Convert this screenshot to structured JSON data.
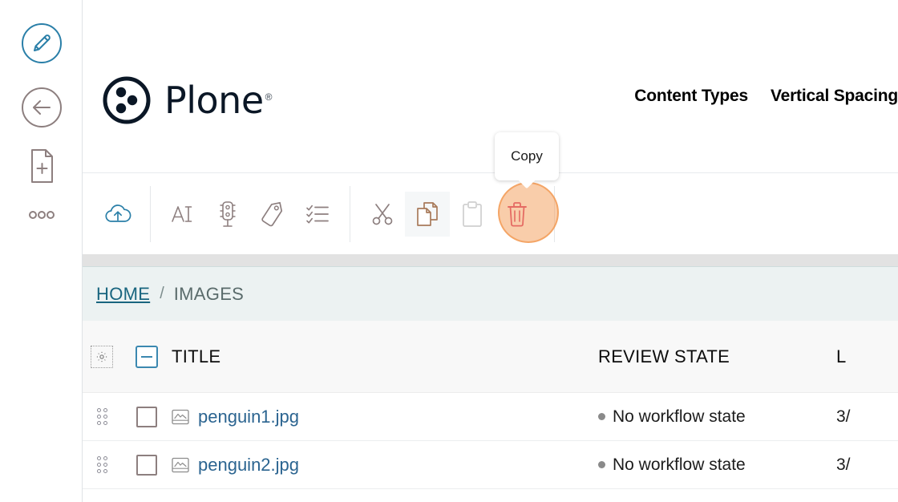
{
  "colors": {
    "brand_dark": "#0b1726",
    "link_blue": "#2b6490",
    "breadcrumb_link": "#19657f",
    "accent_orange": "#f4a05c",
    "delete_red": "#d6336c",
    "upload_blue": "#2a7fa8",
    "icon_gray": "#8d7f7f",
    "band_gray": "#e2e2e2",
    "breadcrumb_bg": "#ecf2f2"
  },
  "rail": {
    "items": [
      {
        "name": "edit-icon",
        "label": "Edit"
      },
      {
        "name": "back-arrow-icon",
        "label": "Back"
      },
      {
        "name": "add-document-icon",
        "label": "Add new"
      },
      {
        "name": "more-options-icon",
        "label": "More"
      }
    ]
  },
  "header": {
    "brand_name": "Plone",
    "brand_registered": "®",
    "logo_icon": "plone-logo-icon",
    "nav": [
      {
        "label": "Content Types",
        "name": "nav-content-types"
      },
      {
        "label": "Vertical Spacing",
        "name": "nav-vertical-spacing"
      }
    ]
  },
  "toolbar": {
    "tooltip": "Copy",
    "buttons": [
      {
        "name": "upload-button",
        "icon": "cloud-upload-icon",
        "label": "Upload",
        "state": "enabled",
        "color": "#2a7fa8"
      },
      {
        "name": "rename-button",
        "icon": "rename-ai-icon",
        "label": "Rename",
        "state": "enabled",
        "color": "#8d7f7f"
      },
      {
        "name": "workflow-button",
        "icon": "traffic-light-icon",
        "label": "State",
        "state": "enabled",
        "color": "#8d7f7f"
      },
      {
        "name": "tags-button",
        "icon": "tag-icon",
        "label": "Tags",
        "state": "enabled",
        "color": "#8d7f7f"
      },
      {
        "name": "properties-button",
        "icon": "checklist-icon",
        "label": "Properties",
        "state": "enabled",
        "color": "#8d7f7f"
      },
      {
        "name": "cut-button",
        "icon": "scissors-icon",
        "label": "Cut",
        "state": "enabled",
        "color": "#8d7f7f"
      },
      {
        "name": "copy-button",
        "icon": "copy-documents-icon",
        "label": "Copy",
        "state": "active",
        "color": "#a87a5a"
      },
      {
        "name": "paste-button",
        "icon": "clipboard-icon",
        "label": "Paste",
        "state": "disabled",
        "color": "#cfcfcf"
      },
      {
        "name": "delete-button",
        "icon": "trash-icon",
        "label": "Delete",
        "state": "enabled",
        "color": "#d6336c"
      }
    ]
  },
  "breadcrumb": {
    "home": "HOME",
    "separator": "/",
    "current": "IMAGES"
  },
  "table": {
    "settings_icon": "gear-icon",
    "select_all_state": "indeterminate",
    "columns": [
      {
        "label": "TITLE",
        "name": "column-title"
      },
      {
        "label": "REVIEW STATE",
        "name": "column-review-state"
      },
      {
        "label": "L",
        "name": "column-last-modified"
      }
    ],
    "rows": [
      {
        "title": "penguin1.jpg",
        "icon": "image-file-icon",
        "review_state": "No workflow state",
        "date": "3/",
        "checked": false
      },
      {
        "title": "penguin2.jpg",
        "icon": "image-file-icon",
        "review_state": "No workflow state",
        "date": "3/",
        "checked": false
      }
    ]
  }
}
